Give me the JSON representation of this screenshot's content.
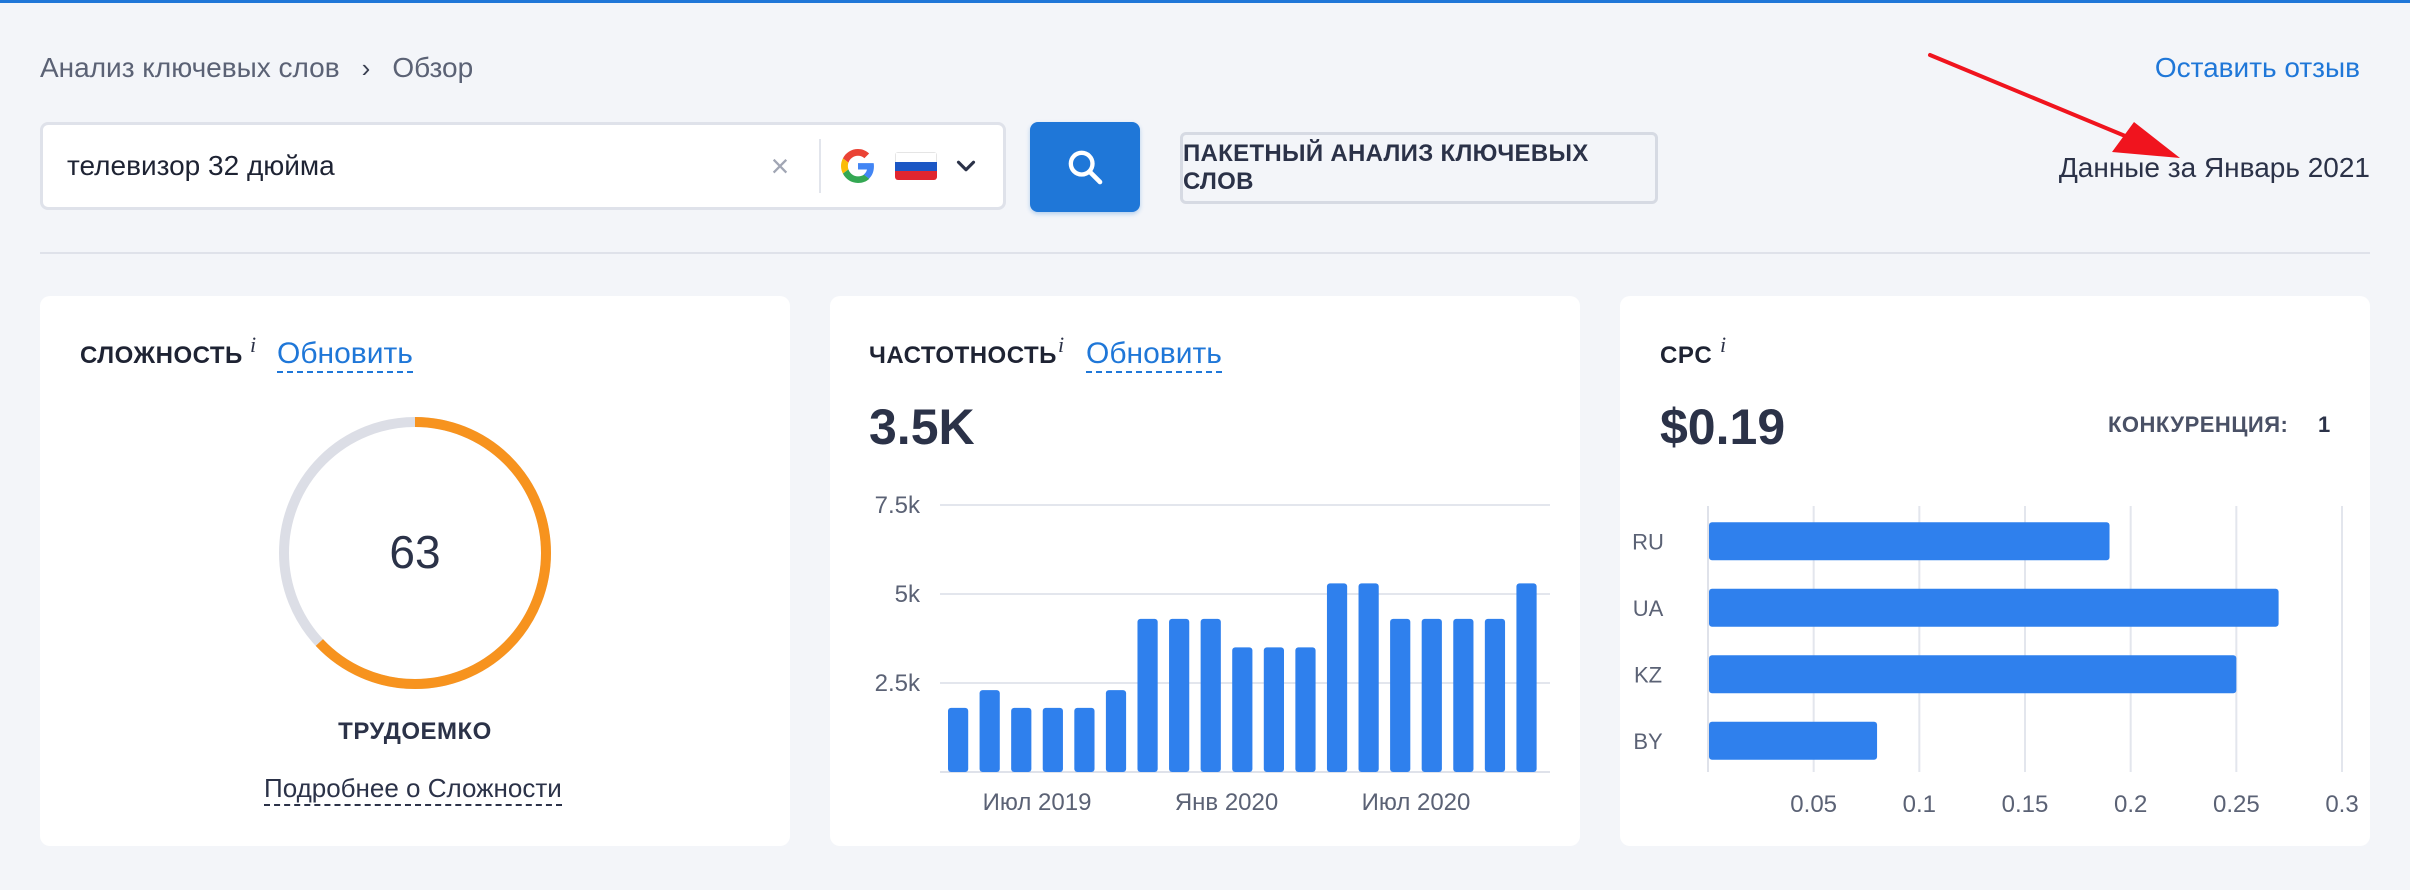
{
  "breadcrumb": {
    "items": [
      "Анализ ключевых слов",
      "Обзор"
    ],
    "separator": "›"
  },
  "feedback_link": "Оставить отзыв",
  "search": {
    "value": "телевизор 32 дюйма",
    "placeholder": "",
    "clear_icon": "×",
    "engine_icon": "google-icon",
    "country_flag": "russia-flag"
  },
  "batch_button": "ПАКЕТНЫЙ АНАЛИЗ КЛЮЧЕВЫХ СЛОВ",
  "data_date": "Данные за Январь 2021",
  "difficulty": {
    "title": "СЛОЖНОСТЬ",
    "info": "i",
    "refresh": "Обновить",
    "value": "63",
    "percent": 63,
    "label": "ТРУДОЕМКО",
    "more_link": "Подробнее о Сложности",
    "color": "#f7931e"
  },
  "volume": {
    "title": "ЧАСТОТНОСТЬ",
    "info": "i",
    "refresh": "Обновить",
    "value": "3.5K"
  },
  "cpc": {
    "title": "CPC",
    "info": "i",
    "value": "$0.19",
    "competition_label": "КОНКУРЕНЦИЯ:",
    "competition_value": "1"
  },
  "chart_data": [
    {
      "type": "bar",
      "title": "ЧАСТОТНОСТЬ",
      "x": [
        "2019-03",
        "2019-04",
        "2019-05",
        "2019-06",
        "2019-07",
        "2019-08",
        "2019-09",
        "2019-10",
        "2019-11",
        "2019-12",
        "2020-01",
        "2020-02",
        "2020-03",
        "2020-04",
        "2020-05",
        "2020-06",
        "2020-07",
        "2020-08",
        "2020-09"
      ],
      "values": [
        1800,
        2300,
        1800,
        1800,
        1800,
        2300,
        4300,
        4300,
        4300,
        3500,
        3500,
        3500,
        5300,
        5300,
        4300,
        4300,
        4300,
        4300,
        5300
      ],
      "ylim": [
        0,
        7500
      ],
      "yticks": [
        "2.5k",
        "5k",
        "7.5k"
      ],
      "ytick_values": [
        2500,
        5000,
        7500
      ],
      "xticks": [
        "Июл 2019",
        "Янв 2020",
        "Июл 2020"
      ],
      "xtick_index": [
        2.5,
        8.5,
        14.5
      ],
      "grid": true,
      "color": "#2f80ed"
    },
    {
      "type": "bar",
      "orientation": "horizontal",
      "title": "CPC",
      "categories": [
        "RU",
        "UA",
        "KZ",
        "BY"
      ],
      "values": [
        0.19,
        0.27,
        0.25,
        0.08
      ],
      "xlim": [
        0,
        0.3
      ],
      "xticks": [
        "0.05",
        "0.1",
        "0.15",
        "0.2",
        "0.25",
        "0.3"
      ],
      "xtick_values": [
        0.05,
        0.1,
        0.15,
        0.2,
        0.25,
        0.3
      ],
      "grid": true,
      "color": "#2f80ed"
    }
  ]
}
